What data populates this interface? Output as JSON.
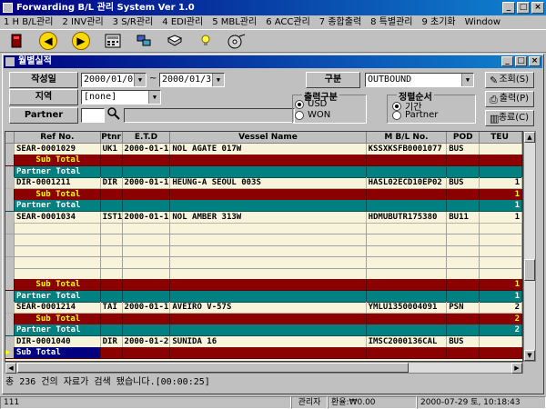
{
  "app": {
    "title": "Forwarding B/L 관리 System Ver 1.0"
  },
  "menu": [
    "1 H B/L관리",
    "2 INV관리",
    "3 S/R관리",
    "4 EDI관리",
    "5 MBL관리",
    "6 ACC관리",
    "7 종합출력",
    "8 특별관리",
    "9 초기화",
    "Window"
  ],
  "child": {
    "title": "월별실적"
  },
  "form": {
    "date_label": "작성일",
    "date_from": "2000/01/01",
    "date_sep": "~",
    "date_to": "2000/01/31",
    "region_label": "지역",
    "region_value": "[none]",
    "partner_label": "Partner",
    "category_label": "구분",
    "category_value": "OUTBOUND",
    "output_group": {
      "legend": "출력구분",
      "opt1": "USD",
      "opt2": "WON"
    },
    "sort_group": {
      "legend": "정렬순서",
      "opt1": "기간",
      "opt2": "Partner"
    }
  },
  "buttons": {
    "search": "조회(S)",
    "print": "출력(P)",
    "close": "종료(C)"
  },
  "grid": {
    "columns": [
      "Ref No.",
      "Ptnr",
      "E.T.D",
      "Vessel Name",
      "M B/L No.",
      "POD",
      "TEU"
    ],
    "rows": [
      {
        "type": "data",
        "ref": "SEAR-0001029",
        "ptnr": "UK1",
        "etd": "2000-01-17",
        "vessel": "NOL AGATE 017W",
        "mbl": "KSSXKSFB0001077",
        "pod": "BUS",
        "teu": ""
      },
      {
        "type": "sub",
        "label": "Sub Total",
        "teu": ""
      },
      {
        "type": "partner",
        "label": "Partner Total",
        "teu": ""
      },
      {
        "type": "data",
        "ref": "DIR-0001211",
        "ptnr": "DIR",
        "etd": "2000-01-18",
        "vessel": "HEUNG-A SEOUL 003S",
        "mbl": "HASL02ECD10EP02",
        "pod": "BUS",
        "teu": "1"
      },
      {
        "type": "sub",
        "label": "Sub Total",
        "teu": "1"
      },
      {
        "type": "partner",
        "label": "Partner Total",
        "teu": "1"
      },
      {
        "type": "data",
        "ref": "SEAR-0001034",
        "ptnr": "IST1",
        "etd": "2000-01-18",
        "vessel": "NOL AMBER 313W",
        "mbl": "HDMUBUTR175380",
        "pod": "BU11",
        "teu": "1"
      },
      {
        "type": "empty"
      },
      {
        "type": "empty"
      },
      {
        "type": "empty"
      },
      {
        "type": "empty"
      },
      {
        "type": "empty"
      },
      {
        "type": "sub",
        "label": "Sub Total",
        "teu": "1"
      },
      {
        "type": "partner",
        "label": "Partner Total",
        "teu": "1"
      },
      {
        "type": "data",
        "ref": "SEAR-0001214",
        "ptnr": "TAI",
        "etd": "2000-01-19",
        "vessel": "AVEIRO V-57S",
        "mbl": "YMLU1350004091",
        "pod": "PSN",
        "teu": "2"
      },
      {
        "type": "sub",
        "label": "Sub Total",
        "teu": "2"
      },
      {
        "type": "partner",
        "label": "Partner Total",
        "teu": "2"
      },
      {
        "type": "data",
        "ref": "DIR-0001040",
        "ptnr": "DIR",
        "etd": "2000-01-20",
        "vessel": "SUNIDA 16",
        "mbl": "IMSC2000136CAL",
        "pod": "BUS",
        "teu": ""
      },
      {
        "type": "sub",
        "label": "Sub Total",
        "teu": "",
        "current": true
      }
    ]
  },
  "message": "총 236 건의 자료가 검색 됐습니다.[00:00:25]",
  "status": {
    "code": "111",
    "user": "관리자",
    "rate": "환율:₩0.00",
    "datetime": "2000-07-29 토, 10:18:43"
  },
  "colors": {
    "subtotal": "#8b0000",
    "partnertotal": "#008080",
    "gridbg": "#f8f4dc",
    "titlebar": "#000080"
  }
}
